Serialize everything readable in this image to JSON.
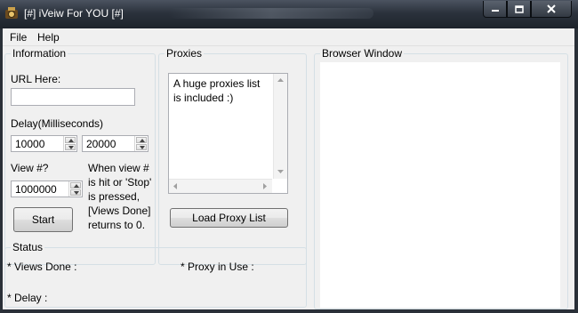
{
  "window": {
    "title": "[#] iVeiw For YOU [#]",
    "caption_buttons": [
      "minimize-icon",
      "maximize-icon",
      "close-icon"
    ]
  },
  "menu": {
    "items": [
      "File",
      "Help"
    ]
  },
  "information": {
    "legend": "Information",
    "url_label": "URL Here:",
    "url_value": "",
    "delay_label": "Delay(Milliseconds)",
    "delay_min": "10000",
    "delay_max": "20000",
    "view_label": "View #?",
    "view_value": "1000000",
    "note": [
      "When view #",
      "is hit or 'Stop'",
      "is pressed,",
      "[Views Done]",
      "returns to 0."
    ],
    "start_button": "Start"
  },
  "proxies": {
    "legend": "Proxies",
    "list_text": [
      "A huge proxies list",
      "is included :)"
    ],
    "load_button": "Load Proxy List"
  },
  "browser": {
    "legend": "Browser Window"
  },
  "status": {
    "legend": "Status",
    "views_done": "* Views Done :",
    "proxy_in_use": "* Proxy in Use :",
    "delay": "* Delay :"
  },
  "colors": {
    "titlebar": "#2b323c",
    "window_bg": "#f0f0f0",
    "group_border": "#d5dfe5"
  }
}
